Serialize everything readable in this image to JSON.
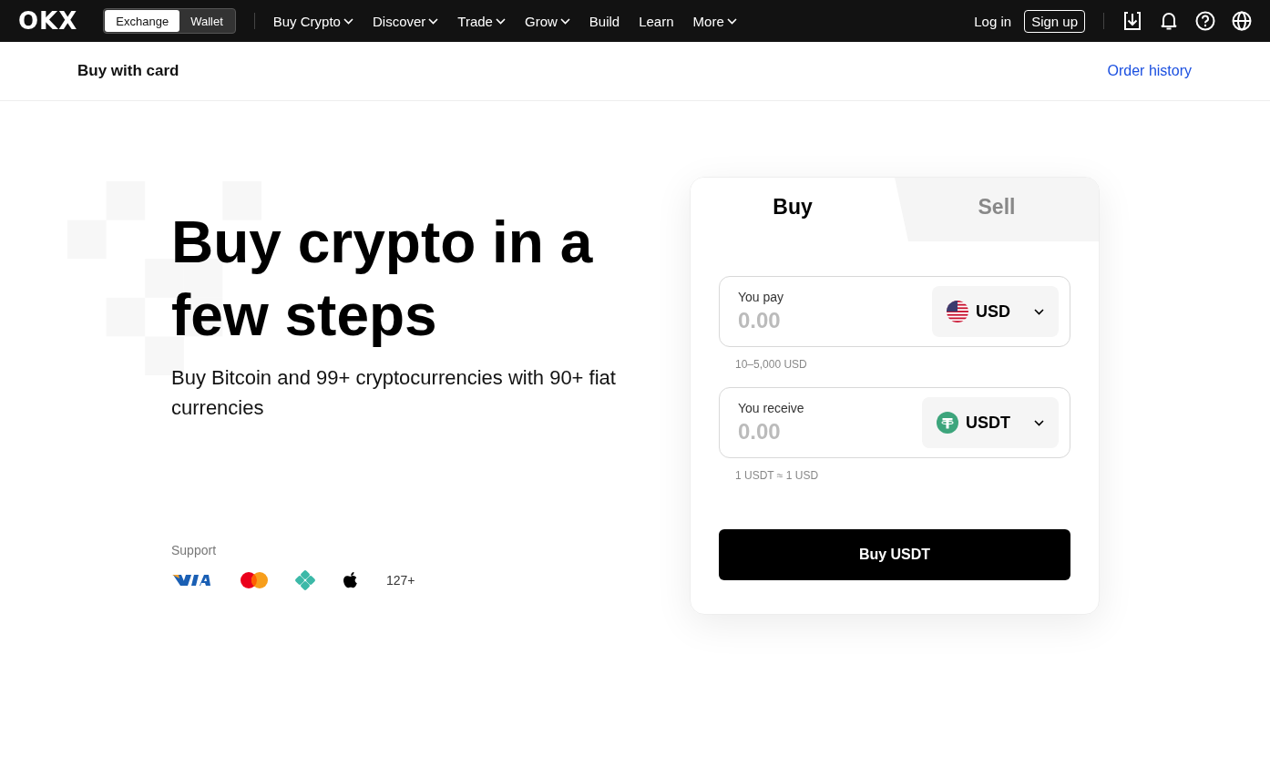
{
  "nav": {
    "logo": "OKX",
    "switch": [
      {
        "label": "Exchange",
        "selected": true
      },
      {
        "label": "Wallet",
        "selected": false
      }
    ],
    "items": [
      {
        "label": "Buy Crypto",
        "dropdown": true
      },
      {
        "label": "Discover",
        "dropdown": true
      },
      {
        "label": "Trade",
        "dropdown": true
      },
      {
        "label": "Grow",
        "dropdown": true
      },
      {
        "label": "Build",
        "dropdown": false
      },
      {
        "label": "Learn",
        "dropdown": false
      },
      {
        "label": "More",
        "dropdown": true
      }
    ],
    "login": "Log in",
    "signup": "Sign up",
    "icons": [
      {
        "kind": "download"
      },
      {
        "kind": "bell"
      },
      {
        "kind": "help"
      },
      {
        "kind": "globe"
      }
    ]
  },
  "subheader": {
    "title": "Buy with card",
    "link": "Order history"
  },
  "hero": {
    "title": "Buy crypto in a few steps",
    "subtitle": "Buy Bitcoin and 99+ cryptocurrencies with 90+ fiat currencies",
    "support_label": "Support",
    "payments": [
      {
        "kind": "visa"
      },
      {
        "kind": "mastercard"
      },
      {
        "kind": "diamond"
      },
      {
        "kind": "apple"
      }
    ],
    "more": "127+"
  },
  "card": {
    "tabs": [
      {
        "label": "Buy",
        "selected": true
      },
      {
        "label": "Sell",
        "selected": false
      }
    ],
    "fields": [
      {
        "label": "You pay",
        "placeholder": "0.00",
        "currency": "USD",
        "kind": "flag",
        "hint": "10–5,000 USD"
      },
      {
        "label": "You receive",
        "placeholder": "0.00",
        "currency": "USDT",
        "kind": "token",
        "hint": "1 USDT ≈ 1 USD"
      }
    ],
    "button": "Buy USDT"
  }
}
